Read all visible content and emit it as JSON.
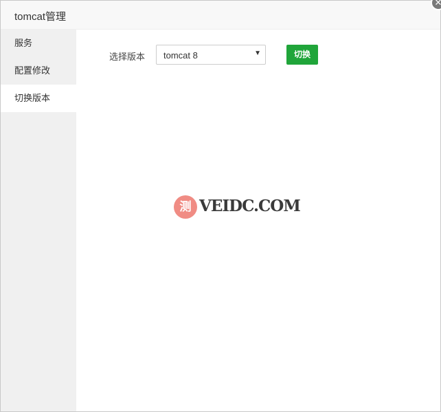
{
  "window": {
    "title": "tomcat管理",
    "close_glyph": "✕"
  },
  "sidebar": {
    "items": [
      {
        "label": "服务",
        "active": false
      },
      {
        "label": "配置修改",
        "active": false
      },
      {
        "label": "切换版本",
        "active": true
      }
    ]
  },
  "main": {
    "version_label": "选择版本",
    "version_select": {
      "value": "tomcat 8",
      "arrow": "▼"
    },
    "switch_button": "切换",
    "accent_color": "#20a53a"
  },
  "watermark": {
    "glyph": "测",
    "text": "VEIDC.COM"
  }
}
